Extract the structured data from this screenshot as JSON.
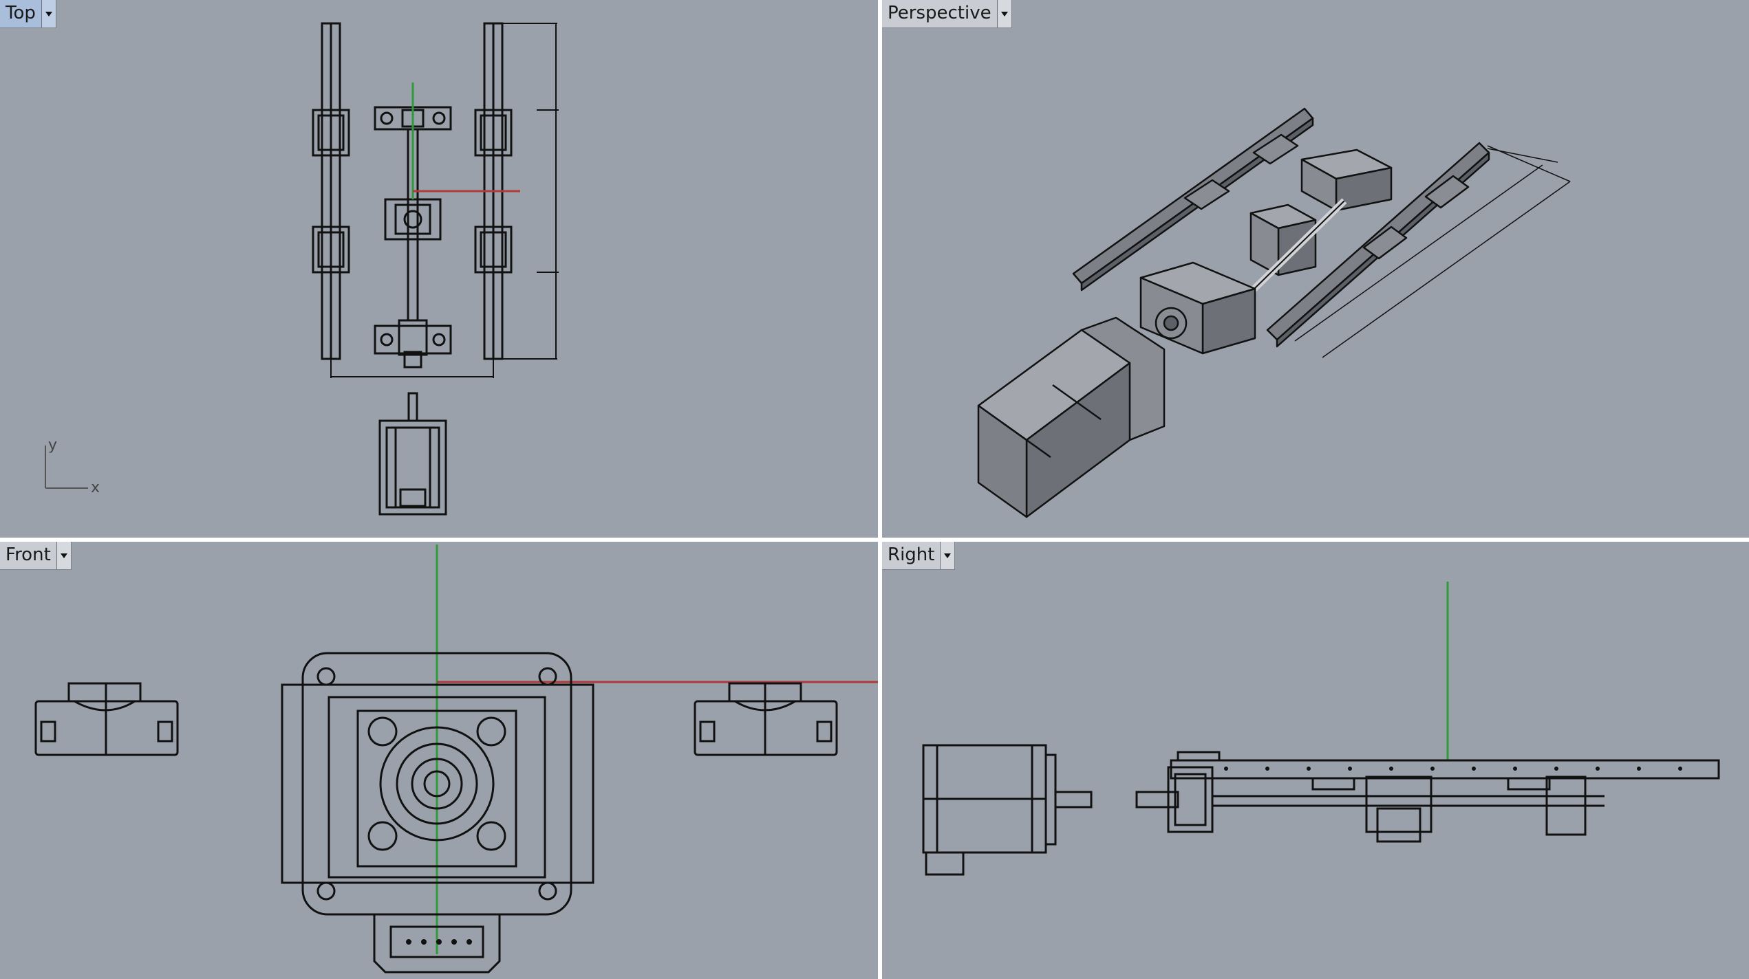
{
  "viewports": {
    "top": {
      "label": "Top",
      "active": true,
      "axis_x": "x",
      "axis_y": "y"
    },
    "perspective": {
      "label": "Perspective"
    },
    "front": {
      "label": "Front"
    },
    "right": {
      "label": "Right"
    }
  },
  "icons": {
    "viewport_menu": "chevron-down-icon"
  },
  "colors": {
    "viewport_bg": "#9aa1ab",
    "active_tab": "#a9bedb",
    "x_axis": "#b03a3a",
    "y_axis": "#2e9a3a",
    "wire": "#111111"
  }
}
